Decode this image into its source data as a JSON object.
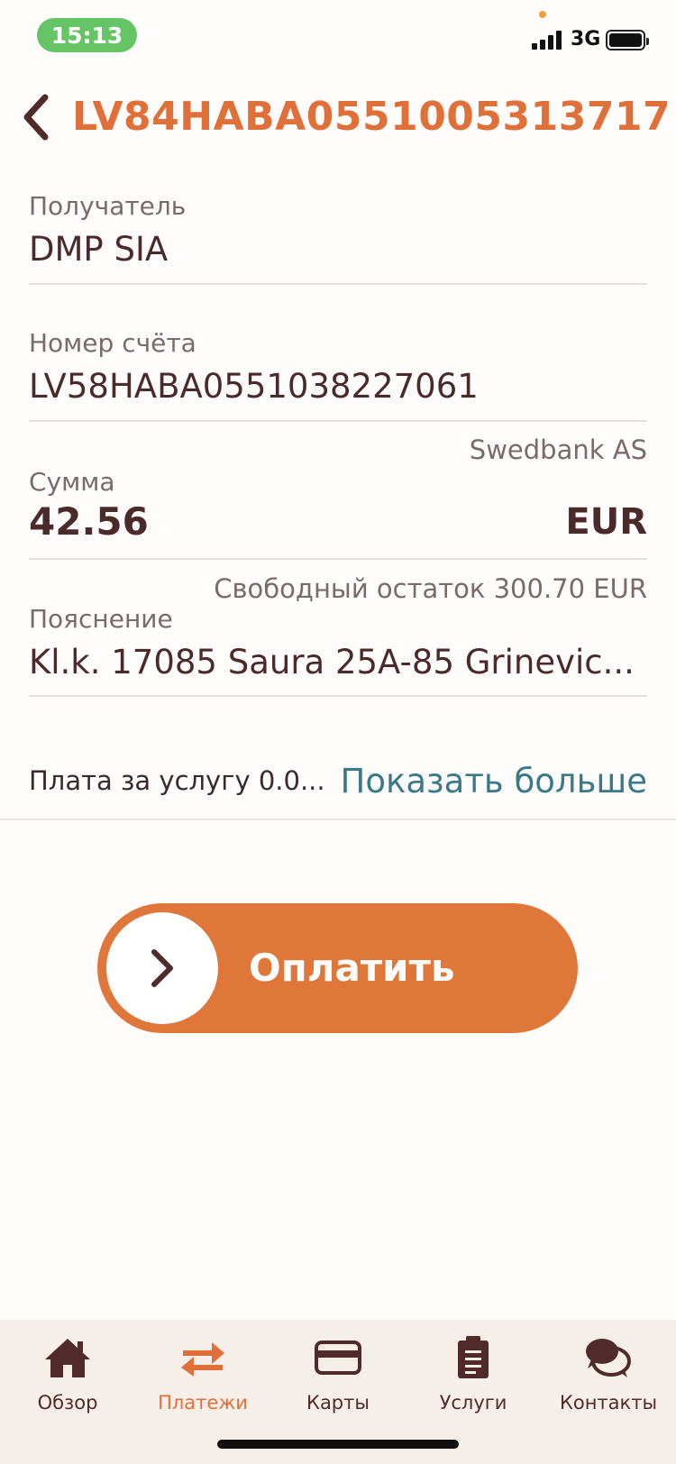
{
  "status_bar": {
    "time": "15:13",
    "network": "3G"
  },
  "header": {
    "title": "LV84HABA0551005313717"
  },
  "form": {
    "recipient": {
      "label": "Получатель",
      "value": "DMP SIA"
    },
    "account": {
      "label": "Номер счёта",
      "value": "LV58HABA0551038227061",
      "bank": "Swedbank AS"
    },
    "amount": {
      "label": "Сумма",
      "value": "42.56",
      "currency": "EUR",
      "available": "Свободный остаток 300.70 EUR"
    },
    "description": {
      "label": "Пояснение",
      "value": "Kl.k. 17085 Saura 25A-85 Grinevic..."
    }
  },
  "fee": {
    "text": "Плата за услугу 0.0...",
    "show_more": "Показать больше"
  },
  "pay_button": {
    "label": "Оплатить"
  },
  "tabs": [
    {
      "label": "Обзор",
      "icon": "home-icon",
      "active": false
    },
    {
      "label": "Платежи",
      "icon": "transfer-arrows-icon",
      "active": true
    },
    {
      "label": "Карты",
      "icon": "card-icon",
      "active": false
    },
    {
      "label": "Услуги",
      "icon": "clipboard-icon",
      "active": false
    },
    {
      "label": "Контакты",
      "icon": "chat-bubbles-icon",
      "active": false
    }
  ],
  "colors": {
    "accent": "#e0703a",
    "text": "#4a2a2a",
    "link": "#3a7a88",
    "tab_bar": "#f6eee9"
  }
}
